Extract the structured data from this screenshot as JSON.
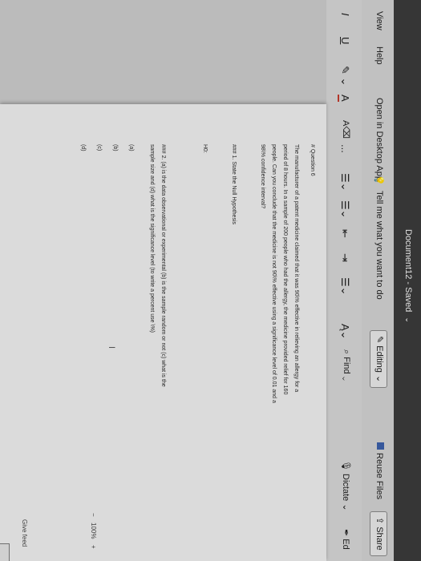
{
  "app": {
    "document_title": "Document12 - Saved"
  },
  "menu": {
    "view": "View",
    "help": "Help",
    "open_in_desktop": "Open in Desktop App",
    "tell_me": "Tell me what you want to do",
    "editing": "Editing",
    "reuse_files": "Reuse Files",
    "share": "Share"
  },
  "ribbon": {
    "italic": "I",
    "underline": "U",
    "highlight": "A",
    "font_color": "A",
    "more": "...",
    "bullets": "☰",
    "numbering": "☰",
    "decrease_indent": "⇤",
    "increase_indent": "⇥",
    "align": "☰",
    "styles": "A",
    "find": "Find",
    "dictate": "Dictate",
    "editor": "Ed"
  },
  "document": {
    "lines": [
      "# Question 6",
      "The manufacturer of a patent medicine claimed that it was 90\\% effective in relieving an allergy for a",
      "period of 8 hours. In a sample of 200 people who had the allergy, the medicine provided relief for 160",
      "people. Can you conclude that the medicine is not 90\\% effective using a significance level of 0.01 and a",
      "98\\% confidence interval?",
      "### 1. State the Null Hypothesis",
      "H0:",
      "### 2. (a) is the data observational or experimental (b) is the sample random or not (c) what is the",
      "sample size and (d) what is the significance level (to write a percent use \\%)",
      "(a)",
      "(b)",
      "(c)",
      "(d)"
    ]
  },
  "status": {
    "zoom": "100%",
    "feedback": "Give feed"
  },
  "colors": {
    "titlebar": "#3a3a3a",
    "ribbon": "#d4d4d4",
    "page": "#ececec"
  }
}
